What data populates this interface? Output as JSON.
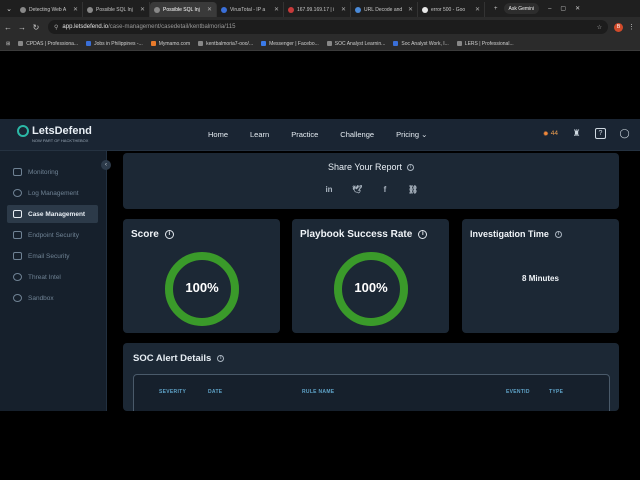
{
  "browser": {
    "tabs": [
      {
        "title": "Detecting Web A",
        "active": false
      },
      {
        "title": "Possible SQL Inj",
        "active": false
      },
      {
        "title": "Possible SQL Inj",
        "active": true
      },
      {
        "title": "VirusTotal - IP a",
        "active": false
      },
      {
        "title": "167.99.169.17 | i",
        "active": false
      },
      {
        "title": "URL Decode and",
        "active": false
      },
      {
        "title": "error 500 - Goo",
        "active": false
      }
    ],
    "ask_gemini": "Ask Gemini",
    "url_host": "app.letsdefend.io",
    "url_path": "/case-management/casedetail/kentbalmoria/115",
    "profile_initial": "B",
    "bookmarks": [
      "CPDAS | Professiona...",
      "Jobs in Philippines -...",
      "Mymamo.com",
      "kentbalmoria7-ooo/...",
      "Messenger | Facebo...",
      "SOC Analyst Learnin...",
      "Soc Analyst Work, I...",
      "LERS | Professional..."
    ]
  },
  "header": {
    "brand": "LetsDefend",
    "brand_sub": "NOW PART OF HACKTHEBOX",
    "nav": [
      "Home",
      "Learn",
      "Practice",
      "Challenge",
      "Pricing"
    ],
    "streak": "44",
    "colors": {
      "accent": "#2bb8a6",
      "streak": "#f0873a"
    }
  },
  "sidebar": {
    "items": [
      {
        "label": "Monitoring",
        "icon": "monitor-icon"
      },
      {
        "label": "Log Management",
        "icon": "search-icon"
      },
      {
        "label": "Case Management",
        "icon": "folder-icon",
        "active": true
      },
      {
        "label": "Endpoint Security",
        "icon": "computer-icon"
      },
      {
        "label": "Email Security",
        "icon": "mail-icon"
      },
      {
        "label": "Threat Intel",
        "icon": "radar-icon"
      },
      {
        "label": "Sandbox",
        "icon": "gear-icon"
      }
    ]
  },
  "share": {
    "title": "Share Your Report",
    "icons": [
      "linkedin-icon",
      "twitter-icon",
      "facebook-icon",
      "link-icon"
    ]
  },
  "metrics": {
    "score": {
      "title": "Score",
      "value": "100%",
      "fraction": 1.0
    },
    "playbook": {
      "title": "Playbook Success Rate",
      "value": "100%",
      "fraction": 1.0
    },
    "investigation": {
      "title": "Investigation Time",
      "value": "8 Minutes"
    },
    "ring_color": "#3a9a2a"
  },
  "alerts": {
    "title": "SOC Alert Details",
    "columns": [
      "SEVERITY",
      "DATE",
      "RULE NAME",
      "EVENTID",
      "TYPE"
    ]
  }
}
